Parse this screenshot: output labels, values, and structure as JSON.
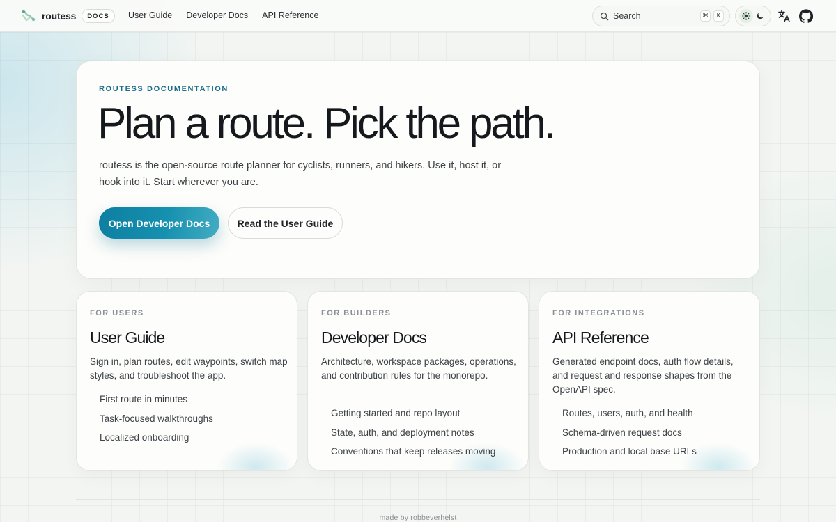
{
  "header": {
    "brand_name": "routess",
    "brand_badge": "DOCS",
    "nav": [
      {
        "label": "User Guide"
      },
      {
        "label": "Developer Docs"
      },
      {
        "label": "API Reference"
      }
    ],
    "search": {
      "label": "Search",
      "shortcut": [
        "⌘",
        "K"
      ]
    },
    "theme": {
      "active": "light"
    }
  },
  "hero": {
    "eyebrow": "ROUTESS DOCUMENTATION",
    "title": "Plan a route. Pick the path.",
    "description": "routess is the open-source route planner for cyclists, runners, and hikers. Use it, host it, or hook into it. Start wherever you are.",
    "primary_cta": "Open Developer Docs",
    "secondary_cta": "Read the User Guide"
  },
  "cards": [
    {
      "eyebrow": "FOR USERS",
      "title": "User Guide",
      "description": "Sign in, plan routes, edit waypoints, switch map styles, and troubleshoot the app.",
      "items": [
        "First route in minutes",
        "Task-focused walkthroughs",
        "Localized onboarding"
      ]
    },
    {
      "eyebrow": "FOR BUILDERS",
      "title": "Developer Docs",
      "description": "Architecture, workspace packages, operations, and contribution rules for the monorepo.",
      "items": [
        "Getting started and repo layout",
        "State, auth, and deployment notes",
        "Conventions that keep releases moving"
      ]
    },
    {
      "eyebrow": "FOR INTEGRATIONS",
      "title": "API Reference",
      "description": "Generated endpoint docs, auth flow details, and request and response shapes from the OpenAPI spec.",
      "items": [
        "Routes, users, auth, and health",
        "Schema-driven request docs",
        "Production and local base URLs"
      ]
    }
  ],
  "footer": {
    "credit": "made by robbeverhelst"
  },
  "colors": {
    "accent": "#1690b0",
    "eyebrow": "#1d6d8c",
    "background": "#f2f5f2"
  }
}
